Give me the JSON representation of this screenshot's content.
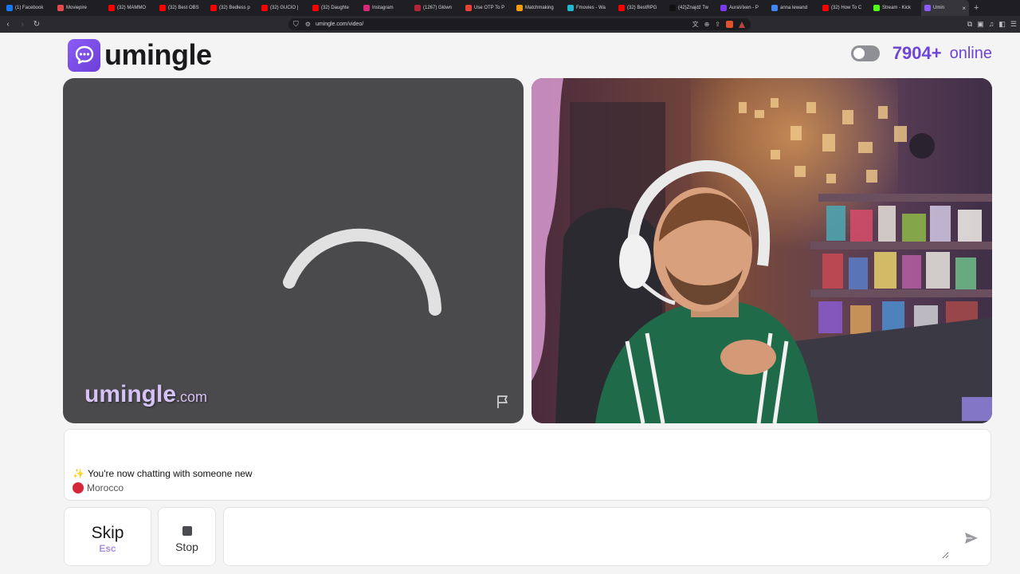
{
  "browser": {
    "tabs": [
      {
        "label": "(1) Facebook",
        "color": "#1877f2"
      },
      {
        "label": "Moviepire",
        "color": "#e14b4b"
      },
      {
        "label": "(32) MAMMO",
        "color": "#ff0000"
      },
      {
        "label": "(32) Best OBS",
        "color": "#ff0000"
      },
      {
        "label": "(32) Bedless p",
        "color": "#ff0000"
      },
      {
        "label": "(32) GUCIO |",
        "color": "#ff0000"
      },
      {
        "label": "(32) Daughte",
        "color": "#ff0000"
      },
      {
        "label": "Instagram",
        "color": "#d62976"
      },
      {
        "label": "(1267) Główn",
        "color": "#b3253a"
      },
      {
        "label": "Use OTP To P",
        "color": "#ea4335"
      },
      {
        "label": "Matchmaking",
        "color": "#f59e0b"
      },
      {
        "label": "Fmovies - Wa",
        "color": "#22b8cf"
      },
      {
        "label": "(32) BestRPG",
        "color": "#ff0000"
      },
      {
        "label": "(42)Znajdź Tw",
        "color": "#111111"
      },
      {
        "label": "AuraVixen - P",
        "color": "#7c3aed"
      },
      {
        "label": "anna lewand",
        "color": "#4285f4"
      },
      {
        "label": "(32) How To C",
        "color": "#ff0000"
      },
      {
        "label": "Stream - Kick",
        "color": "#53fc18"
      },
      {
        "label": "Umin",
        "color": "#8b5cf6",
        "active": true
      }
    ],
    "new_tab": "+",
    "close_tab": "×",
    "url": "umingle.com/video/"
  },
  "header": {
    "logo_text": "umingle",
    "online_count": "7904+",
    "online_label": "online",
    "accent_color": "#6d44d6"
  },
  "video_left": {
    "watermark_main": "umingle",
    "watermark_tld": ".com"
  },
  "chat": {
    "message_icon": "✨",
    "message": "You're now chatting with someone new",
    "country": "Morocco"
  },
  "controls": {
    "skip_label": "Skip",
    "skip_shortcut": "Esc",
    "stop_label": "Stop",
    "message_placeholder": ""
  }
}
